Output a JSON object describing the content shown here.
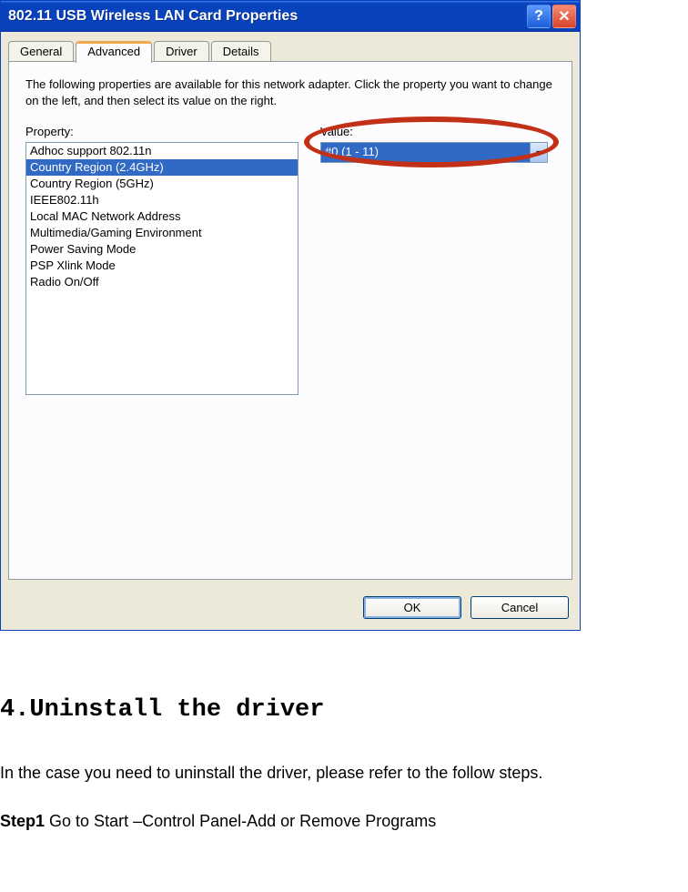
{
  "window": {
    "title": "802.11 USB Wireless LAN Card Properties",
    "tabs": [
      "General",
      "Advanced",
      "Driver",
      "Details"
    ],
    "active_tab_index": 1,
    "intro": "The following properties are available for this network adapter. Click the property you want to change on the left, and then select its value on the right.",
    "property_label": "Property:",
    "value_label": "Value:",
    "properties": [
      "Adhoc support 802.11n",
      "Country Region (2.4GHz)",
      "Country Region (5GHz)",
      "IEEE802.11h",
      "Local MAC Network Address",
      "Multimedia/Gaming Environment",
      "Power Saving Mode",
      "PSP Xlink Mode",
      "Radio On/Off"
    ],
    "selected_property_index": 1,
    "value_combo": "#0 (1 - 11)",
    "buttons": {
      "ok": "OK",
      "cancel": "Cancel"
    }
  },
  "doc": {
    "heading": "4.Uninstall the driver",
    "text": "In the case you need to uninstall the driver, please refer to the follow steps.",
    "step_label": "Step1",
    "step_text": " Go to Start –Control Panel-Add or Remove Programs"
  }
}
